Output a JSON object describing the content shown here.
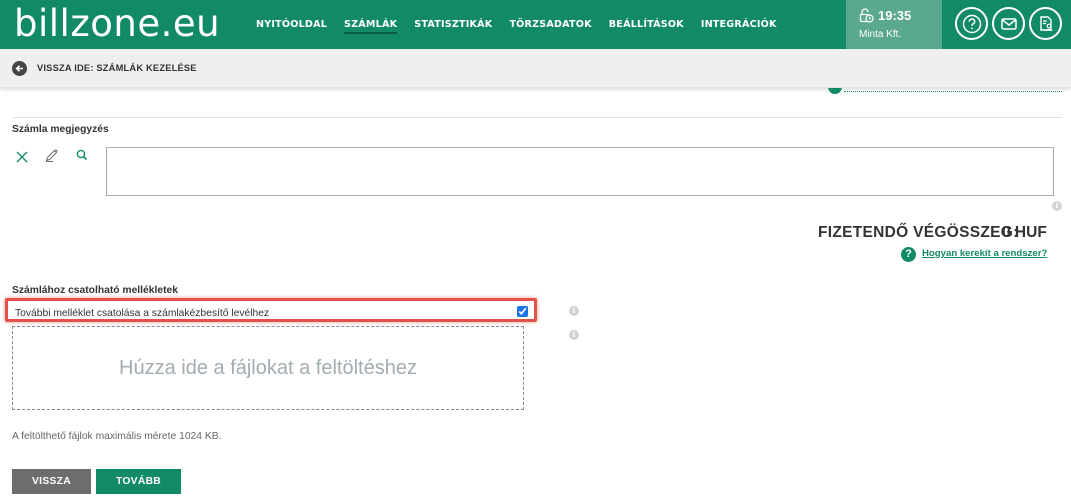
{
  "app": {
    "logo": "billzone.eu",
    "nav": [
      "NYITÓOLDAL",
      "SZÁMLÁK",
      "STATISZTIKÁK",
      "TÖRZSADATOK",
      "BEÁLLÍTÁSOK",
      "INTEGRÁCIÓK"
    ],
    "active_nav": "SZÁMLÁK",
    "time": "19:35",
    "company": "Minta Kft.",
    "brand_color": "#128a67"
  },
  "breadcrumb": {
    "back_label": "VISSZA IDE: SZÁMLÁK KEZELÉSE"
  },
  "note": {
    "label": "Számla megjegyzés",
    "value": ""
  },
  "total": {
    "label": "FIZETENDŐ VÉGÖSSZEG:",
    "value": "0 HUF",
    "help_link": "Hogyan kerekít a rendszer?"
  },
  "attachments": {
    "label": "Számlához csatolható mellékletek",
    "checkbox_label": "További melléklet csatolása a számlakézbesítő levélhez",
    "checked": true,
    "dropzone_text": "Húzza ide a fájlokat a feltöltéshez",
    "size_note": "A feltölthető fájlok maximális mérete 1024 KB."
  },
  "buttons": {
    "back": "VISSZA",
    "next": "TOVÁBB"
  },
  "icons": [
    "clock-icon",
    "help-icon",
    "mail-icon",
    "document-user-icon",
    "back-arrow-icon",
    "clear-icon",
    "edit-icon",
    "search-icon",
    "info-icon",
    "question-icon"
  ]
}
